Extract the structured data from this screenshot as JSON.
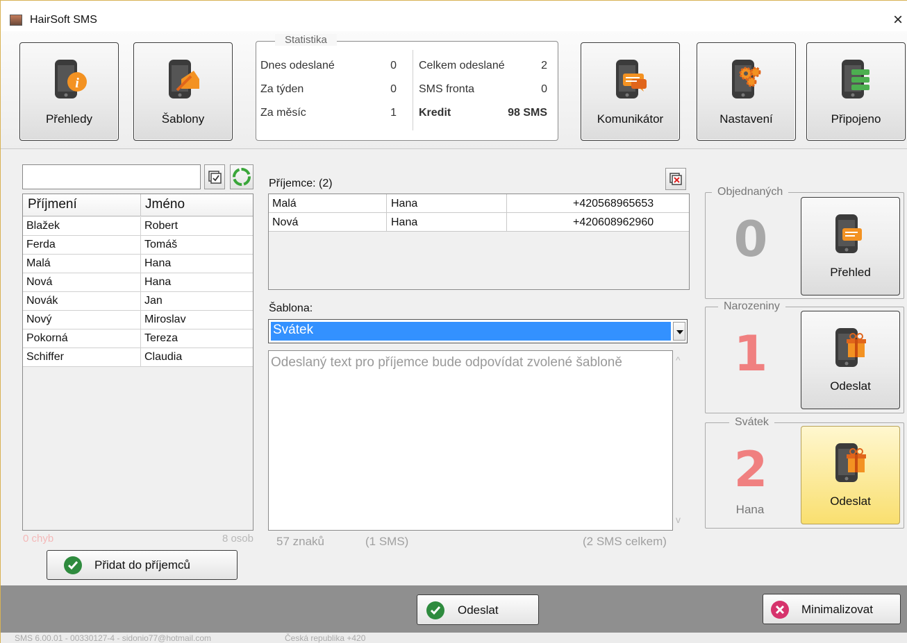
{
  "window": {
    "title": "HairSoft SMS",
    "close_glyph": "×"
  },
  "toolbar": {
    "buttons": [
      {
        "label": "Přehledy",
        "icon": "phone-info-icon"
      },
      {
        "label": "Šablony",
        "icon": "phone-edit-icon"
      },
      {
        "label": "Komunikátor",
        "icon": "phone-chat-icon"
      },
      {
        "label": "Nastavení",
        "icon": "phone-gears-icon"
      },
      {
        "label": "Připojeno",
        "icon": "phone-server-icon"
      }
    ]
  },
  "stats": {
    "legend": "Statistika",
    "left": [
      {
        "label": "Dnes odeslané",
        "value": "0"
      },
      {
        "label": "Za týden",
        "value": "0"
      },
      {
        "label": "Za měsíc",
        "value": "1"
      }
    ],
    "right": [
      {
        "label": "Celkem odeslané",
        "value": "2"
      },
      {
        "label": "SMS fronta",
        "value": "0"
      },
      {
        "label": "Kredit",
        "value": "98 SMS"
      }
    ]
  },
  "contacts": {
    "search_value": "",
    "headers": [
      "Příjmení",
      "Jméno"
    ],
    "rows": [
      [
        "Blažek",
        "Robert"
      ],
      [
        "Ferda",
        "Tomáš"
      ],
      [
        "Malá",
        "Hana"
      ],
      [
        "Nová",
        "Hana"
      ],
      [
        "Novák",
        "Jan"
      ],
      [
        "Nový",
        "Miroslav"
      ],
      [
        "Pokorná",
        "Tereza"
      ],
      [
        "Schiffer",
        "Claudia"
      ]
    ],
    "errors": "0 chyb",
    "count": "8 osob",
    "add_button": "Přidat do příjemců"
  },
  "recipients": {
    "label": "Příjemce: (2)",
    "rows": [
      [
        "Malá",
        "Hana",
        "+420568965653"
      ],
      [
        "Nová",
        "Hana",
        "+420608962960"
      ]
    ]
  },
  "template": {
    "label": "Šablona:",
    "selected": "Svátek",
    "message_placeholder": "Odeslaný text pro příjemce bude odpovídat zvolené šabloně",
    "chars": "57 znaků",
    "sms_count": "(1 SMS)",
    "sms_total": "(2 SMS celkem)"
  },
  "side": {
    "orders": {
      "legend": "Objednaných",
      "count": "0",
      "button": "Přehled"
    },
    "birthdays": {
      "legend": "Narozeniny",
      "count": "1",
      "button": "Odeslat"
    },
    "nameday": {
      "legend": "Svátek",
      "count": "2",
      "name": "Hana",
      "button": "Odeslat"
    }
  },
  "footer": {
    "send": "Odeslat",
    "minimize": "Minimalizovat"
  },
  "statusbar": {
    "version": "SMS 6.00.01 - 00330127-4 - sidonio77@hotmail.com",
    "region": "Česká republika +420"
  },
  "colors": {
    "accent_orange": "#f39222",
    "number_gray": "#a8a8a8",
    "number_red": "#f08080",
    "select_blue": "#3391ff",
    "ok_green": "#2e8b3e",
    "cancel_pink": "#d6336c"
  }
}
